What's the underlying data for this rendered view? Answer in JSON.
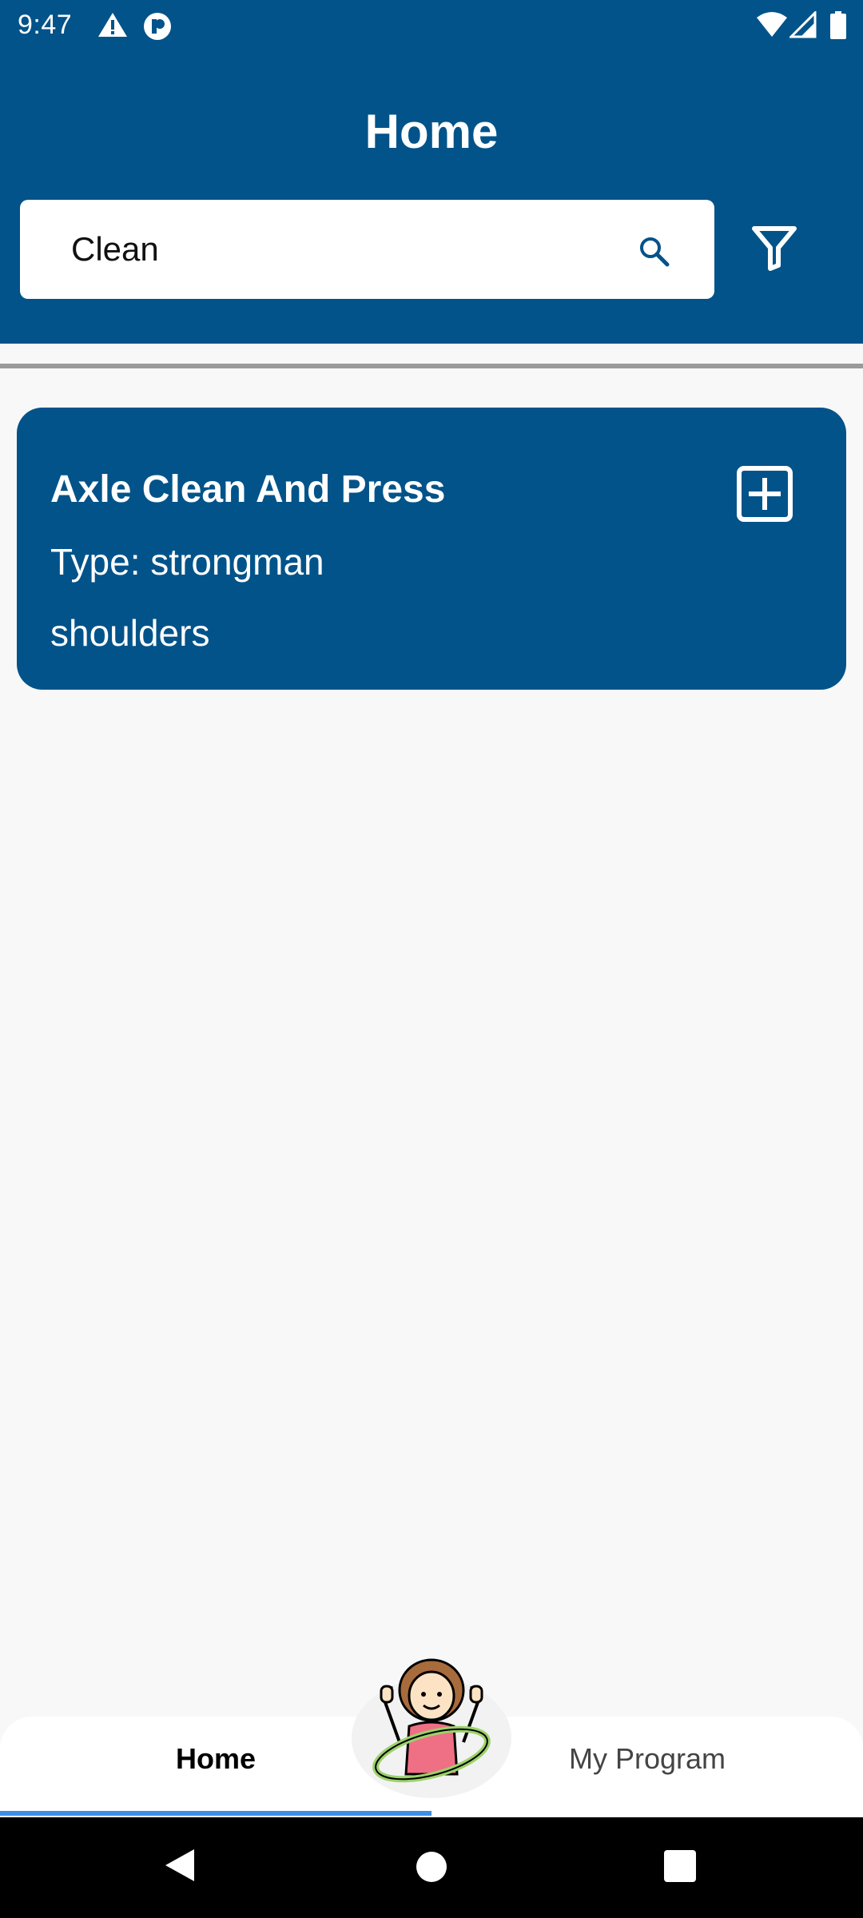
{
  "status_bar": {
    "time": "9:47",
    "icons_left": [
      "warning-icon",
      "app-notification-icon"
    ],
    "icons_right": [
      "wifi-icon",
      "signal-icon",
      "battery-icon"
    ]
  },
  "header": {
    "title": "Home",
    "background_color": "#02538a"
  },
  "search": {
    "value": "Clean",
    "icon": "search-icon",
    "filter_icon": "filter-icon"
  },
  "results": [
    {
      "title": "Axle Clean And Press",
      "type": "Type: strongman",
      "muscle": "shoulders",
      "action_icon": "add-square-icon"
    }
  ],
  "bottom_nav": {
    "items": [
      {
        "label": "Home",
        "active": true
      },
      {
        "label": "My Program",
        "active": false
      }
    ],
    "center_icon": "hula-hoop-mascot-icon",
    "indicator_color": "#3a8ee6"
  },
  "system_nav": {
    "buttons": [
      "back-icon",
      "home-circle-icon",
      "recents-square-icon"
    ]
  }
}
